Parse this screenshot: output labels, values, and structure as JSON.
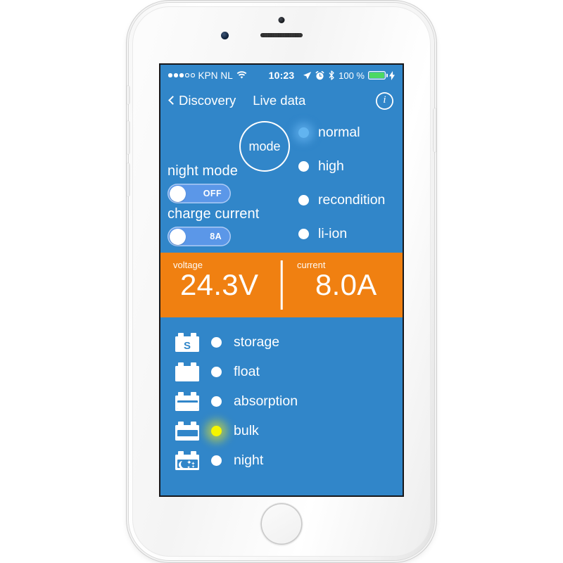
{
  "colors": {
    "screen_blue": "#3186c9",
    "readout_orange": "#f08011",
    "toggle_blue": "#5b97e8",
    "active_mode_dot": "#62b4f0",
    "active_state_dot": "#f5f500",
    "battery_green": "#4cd964"
  },
  "status_bar": {
    "signal_dots_filled": 3,
    "signal_dots_total": 5,
    "carrier": "KPN NL",
    "wifi_icon": "wifi-icon",
    "time": "10:23",
    "location_icon": "location-arrow-icon",
    "alarm_icon": "alarm-clock-icon",
    "bluetooth_icon": "bluetooth-icon",
    "battery_percent": "100 %",
    "charging_icon": "lightning-bolt-icon"
  },
  "nav_bar": {
    "back_label": "Discovery",
    "back_icon": "chevron-left-icon",
    "title": "Live data",
    "info_icon": "info-circle-icon",
    "info_glyph": "i"
  },
  "controls": {
    "mode_button_label": "mode",
    "night_mode": {
      "label": "night mode",
      "value": "OFF"
    },
    "charge_current": {
      "label": "charge current",
      "value": "8A"
    },
    "modes": [
      {
        "label": "normal",
        "selected": true
      },
      {
        "label": "high",
        "selected": false
      },
      {
        "label": "recondition",
        "selected": false
      },
      {
        "label": "li-ion",
        "selected": false
      }
    ]
  },
  "readout": {
    "voltage": {
      "caption": "voltage",
      "value": "24.3V"
    },
    "current": {
      "caption": "current",
      "value": "8.0A"
    }
  },
  "states": [
    {
      "label": "storage",
      "icon": "battery-storage-icon",
      "active": false
    },
    {
      "label": "float",
      "icon": "battery-float-icon",
      "active": false
    },
    {
      "label": "absorption",
      "icon": "battery-absorption-icon",
      "active": false
    },
    {
      "label": "bulk",
      "icon": "battery-bulk-icon",
      "active": true
    },
    {
      "label": "night",
      "icon": "battery-night-icon",
      "active": false
    }
  ]
}
